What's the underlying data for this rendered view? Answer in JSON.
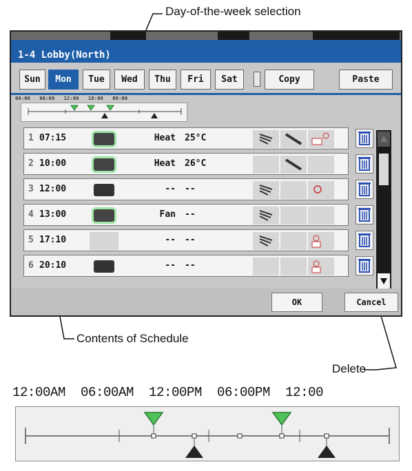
{
  "callouts": {
    "days": "Day-of-the-week selection",
    "contents": "Contents of Schedule",
    "delete": "Delete"
  },
  "window": {
    "title": "1-4 Lobby(North)"
  },
  "days": [
    {
      "label": "Sun",
      "selected": false
    },
    {
      "label": "Mon",
      "selected": true
    },
    {
      "label": "Tue",
      "selected": false
    },
    {
      "label": "Wed",
      "selected": false
    },
    {
      "label": "Thu",
      "selected": false
    },
    {
      "label": "Fri",
      "selected": false
    },
    {
      "label": "Sat",
      "selected": false
    }
  ],
  "actions": {
    "copy": "Copy",
    "paste": "Paste",
    "ok": "OK",
    "cancel": "Cancel"
  },
  "timebar": {
    "labels": "00:00   06:00   12:00   18:00   00:00"
  },
  "schedule": [
    {
      "num": "1",
      "time": "07:15",
      "state": "on",
      "mode": "Heat",
      "temp": "25°C",
      "fan": true,
      "vane": true,
      "sub": "lock-icon"
    },
    {
      "num": "2",
      "time": "10:00",
      "state": "on",
      "mode": "Heat",
      "temp": "26°C",
      "fan": false,
      "vane": true,
      "sub": ""
    },
    {
      "num": "3",
      "time": "12:00",
      "state": "off",
      "mode": "--",
      "temp": "--",
      "fan": true,
      "vane": false,
      "sub": "power-icon"
    },
    {
      "num": "4",
      "time": "13:00",
      "state": "on",
      "mode": "Fan",
      "temp": "--",
      "fan": true,
      "vane": false,
      "sub": ""
    },
    {
      "num": "5",
      "time": "17:10",
      "state": "none",
      "mode": "--",
      "temp": "--",
      "fan": true,
      "vane": false,
      "sub": "power-lock-icon"
    },
    {
      "num": "6",
      "time": "20:10",
      "state": "off",
      "mode": "--",
      "temp": "--",
      "fan": false,
      "vane": false,
      "sub": "power-lock-icon"
    }
  ],
  "bigTimeline": {
    "labels": "12:00AM  06:00AM  12:00PM  06:00PM  12:00"
  },
  "colors": {
    "titleBlue": "#1f5ea8",
    "onGreen": "#4fc25a",
    "offBlack": "#222222",
    "trashBlue": "#2a4fb5"
  }
}
